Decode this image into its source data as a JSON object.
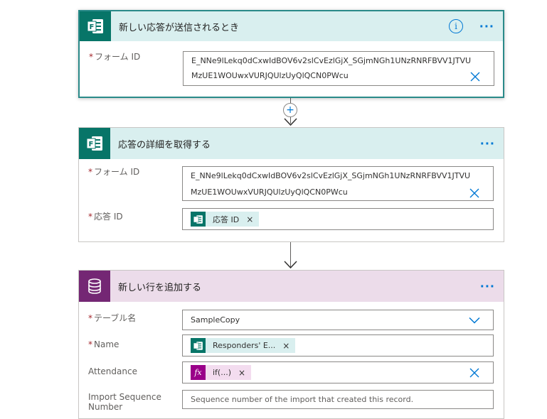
{
  "step1": {
    "title": "新しい応答が送信されるとき",
    "info_glyph": "i",
    "form_label": "フォーム ID",
    "form_value_line1": "E_NNe9lLekq0dCxwIdBOV6v2slCvEzlGjX_SGjmNGh1UNzRNRFBVV1JTVU",
    "form_value_line2": "MzUE1WOUwxVURJQUlzUyQlQCN0PWcu"
  },
  "step2": {
    "title": "応答の詳細を取得する",
    "form_label": "フォーム ID",
    "form_value_line1": "E_NNe9lLekq0dCxwIdBOV6v2slCvEzlGjX_SGjmNGh1UNzRNRFBVV1JTVU",
    "form_value_line2": "MzUE1WOUwxVURJQUlzUyQlQCN0PWcu",
    "response_label": "応答 ID",
    "response_token": "応答 ID"
  },
  "step3": {
    "title": "新しい行を追加する",
    "table_label": "テーブル名",
    "table_value": "SampleCopy",
    "name_label": "Name",
    "name_token": "Responders' E...",
    "attendance_label": "Attendance",
    "attendance_token": "if(...)",
    "attendance_token_icon": "fx",
    "import_label": "Import Sequence Number",
    "import_placeholder": "Sequence number of the import that created this record."
  },
  "common": {
    "required_mark": "*",
    "more_glyph": "···",
    "token_remove_glyph": "×",
    "add_step_glyph": "+"
  },
  "colors": {
    "forms_teal": "#077568",
    "header_teal": "#d9efef",
    "dataverse_purple": "#742774",
    "header_purple": "#ecdcea",
    "accent_blue": "#0078d4",
    "required_red": "#a4262c"
  }
}
